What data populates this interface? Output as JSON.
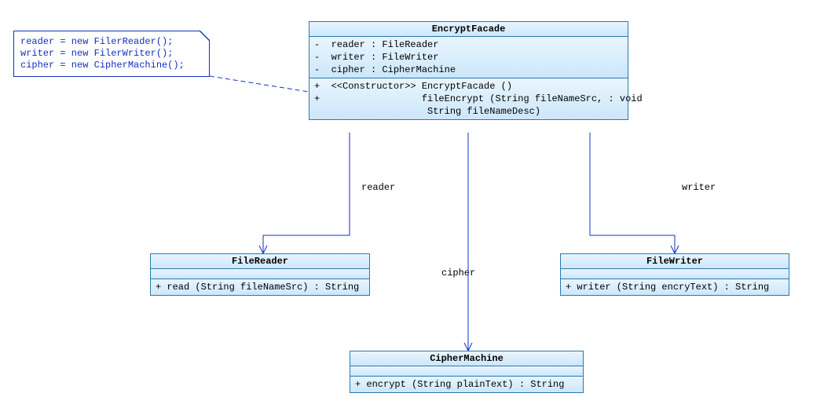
{
  "note": {
    "lines": [
      "reader = new FilerReader();",
      "writer = new FilerWriter();",
      "cipher = new CipherMachine();"
    ]
  },
  "encryptFacade": {
    "title": "EncryptFacade",
    "attrs": [
      "-  reader : FileReader",
      "-  writer : FileWriter",
      "-  cipher : CipherMachine"
    ],
    "ops": [
      "+  <<Constructor>> EncryptFacade ()",
      "+                  fileEncrypt (String fileNameSrc, : void",
      "                    String fileNameDesc)"
    ]
  },
  "fileReader": {
    "title": "FileReader",
    "attrs": [],
    "ops": [
      "+ read (String fileNameSrc) : String"
    ]
  },
  "fileWriter": {
    "title": "FileWriter",
    "attrs": [],
    "ops": [
      "+ writer (String encryText) : String"
    ]
  },
  "cipherMachine": {
    "title": "CipherMachine",
    "attrs": [],
    "ops": [
      "+ encrypt (String plainText) : String"
    ]
  },
  "relations": {
    "reader": "reader",
    "writer": "writer",
    "cipher": "cipher"
  },
  "chart_data": {
    "type": "uml-class-diagram",
    "classes": [
      {
        "name": "EncryptFacade",
        "attributes": [
          {
            "visibility": "-",
            "name": "reader",
            "type": "FileReader"
          },
          {
            "visibility": "-",
            "name": "writer",
            "type": "FileWriter"
          },
          {
            "visibility": "-",
            "name": "cipher",
            "type": "CipherMachine"
          }
        ],
        "operations": [
          {
            "visibility": "+",
            "stereotype": "Constructor",
            "name": "EncryptFacade",
            "params": []
          },
          {
            "visibility": "+",
            "name": "fileEncrypt",
            "params": [
              "String fileNameSrc",
              "String fileNameDesc"
            ],
            "return": "void"
          }
        ]
      },
      {
        "name": "FileReader",
        "attributes": [],
        "operations": [
          {
            "visibility": "+",
            "name": "read",
            "params": [
              "String fileNameSrc"
            ],
            "return": "String"
          }
        ]
      },
      {
        "name": "FileWriter",
        "attributes": [],
        "operations": [
          {
            "visibility": "+",
            "name": "writer",
            "params": [
              "String encryText"
            ],
            "return": "String"
          }
        ]
      },
      {
        "name": "CipherMachine",
        "attributes": [],
        "operations": [
          {
            "visibility": "+",
            "name": "encrypt",
            "params": [
              "String plainText"
            ],
            "return": "String"
          }
        ]
      }
    ],
    "associations": [
      {
        "from": "EncryptFacade",
        "to": "FileReader",
        "role": "reader",
        "navigable": true
      },
      {
        "from": "EncryptFacade",
        "to": "FileWriter",
        "role": "writer",
        "navigable": true
      },
      {
        "from": "EncryptFacade",
        "to": "CipherMachine",
        "role": "cipher",
        "navigable": true
      }
    ],
    "notes": [
      {
        "attachedTo": "EncryptFacade",
        "text": "reader = new FilerReader();\nwriter = new FilerWriter();\ncipher = new CipherMachine();"
      }
    ]
  }
}
